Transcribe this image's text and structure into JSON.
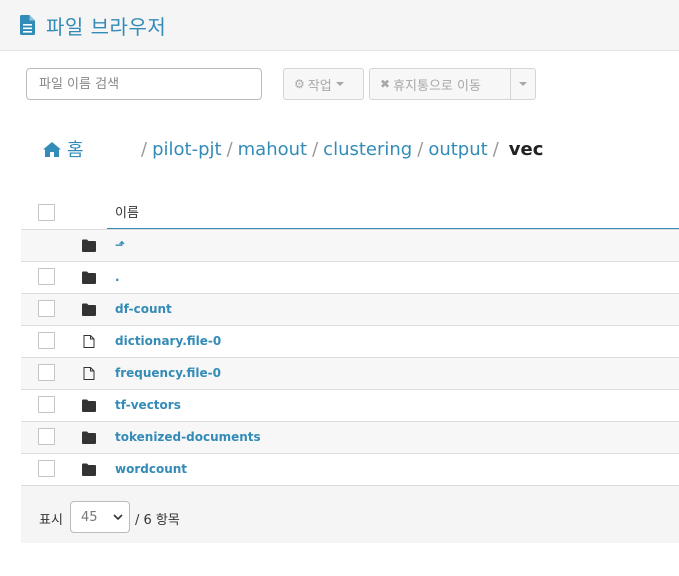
{
  "header": {
    "title": "파일 브라우저",
    "icon": "document-icon",
    "accent": "#338bb8"
  },
  "toolbar": {
    "search_placeholder": "파일 이름 검색",
    "actions_label": "작업",
    "actions_icon": "gear-icon",
    "trash_label": "휴지통으로 이동",
    "trash_icon": "close-icon"
  },
  "breadcrumb": {
    "home_label": "홈",
    "home_icon": "home-icon",
    "links": [
      "pilot-pjt",
      "mahout",
      "clustering",
      "output"
    ],
    "separator": "/",
    "current": "vec"
  },
  "table": {
    "column_name": "이름",
    "rows": [
      {
        "name": "⬏",
        "icon": "folder-icon",
        "checkbox": false
      },
      {
        "name": ".",
        "icon": "folder-icon",
        "checkbox": true
      },
      {
        "name": "df-count",
        "icon": "folder-icon",
        "checkbox": true
      },
      {
        "name": "dictionary.file-0",
        "icon": "file-icon",
        "checkbox": true
      },
      {
        "name": "frequency.file-0",
        "icon": "file-icon",
        "checkbox": true
      },
      {
        "name": "tf-vectors",
        "icon": "folder-icon",
        "checkbox": true
      },
      {
        "name": "tokenized-documents",
        "icon": "folder-icon",
        "checkbox": true
      },
      {
        "name": "wordcount",
        "icon": "folder-icon",
        "checkbox": true
      }
    ]
  },
  "pagination": {
    "show_label": "표시",
    "page_size": "45",
    "total_label": "/ 6 항목"
  }
}
